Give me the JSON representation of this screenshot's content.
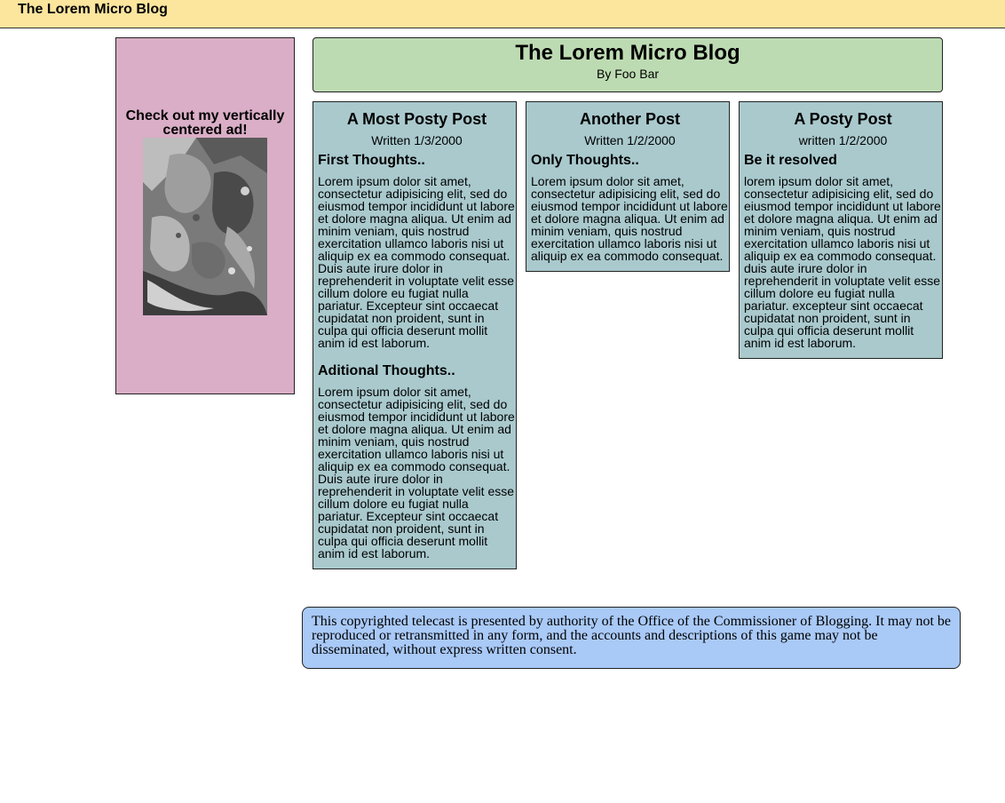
{
  "topbar": {
    "title": "The Lorem Micro Blog"
  },
  "ad": {
    "text": "Check out my vertically centered ad!"
  },
  "header": {
    "title": "The Lorem Micro Blog",
    "byline": "By Foo Bar"
  },
  "posts": [
    {
      "title": "A Most Posty Post",
      "date": "Written 1/3/2000",
      "sections": [
        {
          "heading": "First Thoughts..",
          "body": "Lorem ipsum dolor sit amet, consectetur adipisicing elit, sed do eiusmod tempor incididunt ut labore et dolore magna aliqua. Ut enim ad minim veniam, quis nostrud exercitation ullamco laboris nisi ut aliquip ex ea commodo consequat. Duis aute irure dolor in reprehenderit in voluptate velit esse cillum dolore eu fugiat nulla pariatur. Excepteur sint occaecat cupidatat non proident, sunt in culpa qui officia deserunt mollit anim id est laborum."
        },
        {
          "heading": "Aditional Thoughts..",
          "body": "Lorem ipsum dolor sit amet, consectetur adipisicing elit, sed do eiusmod tempor incididunt ut labore et dolore magna aliqua. Ut enim ad minim veniam, quis nostrud exercitation ullamco laboris nisi ut aliquip ex ea commodo consequat. Duis aute irure dolor in reprehenderit in voluptate velit esse cillum dolore eu fugiat nulla pariatur. Excepteur sint occaecat cupidatat non proident, sunt in culpa qui officia deserunt mollit anim id est laborum."
        }
      ]
    },
    {
      "title": "Another Post",
      "date": "Written 1/2/2000",
      "sections": [
        {
          "heading": "Only Thoughts..",
          "body": "Lorem ipsum dolor sit amet, consectetur adipisicing elit, sed do eiusmod tempor incididunt ut labore et dolore magna aliqua. Ut enim ad minim veniam, quis nostrud exercitation ullamco laboris nisi ut aliquip ex ea commodo consequat."
        }
      ]
    },
    {
      "title": "A Posty Post",
      "date": "written 1/2/2000",
      "sections": [
        {
          "heading": "Be it resolved",
          "body": "lorem ipsum dolor sit amet, consectetur adipisicing elit, sed do eiusmod tempor incididunt ut labore et dolore magna aliqua. Ut enim ad minim veniam, quis nostrud exercitation ullamco laboris nisi ut aliquip ex ea commodo consequat. duis aute irure dolor in reprehenderit in voluptate velit esse cillum dolore eu fugiat nulla pariatur. excepteur sint occaecat cupidatat non proident, sunt in culpa qui officia deserunt mollit anim id est laborum."
        }
      ]
    }
  ],
  "footer": {
    "text": "This copyrighted telecast is presented by authority of the Office of the Commissioner of Blogging. It may not be reproduced or retransmitted in any form, and the accounts and descriptions of this game may not be disseminated, without express written consent."
  },
  "colors": {
    "topbar": "#fce59d",
    "ad": "#d9aec6",
    "header": "#bddbb2",
    "post": "#a9c9cd",
    "footer": "#a9c9f7"
  }
}
